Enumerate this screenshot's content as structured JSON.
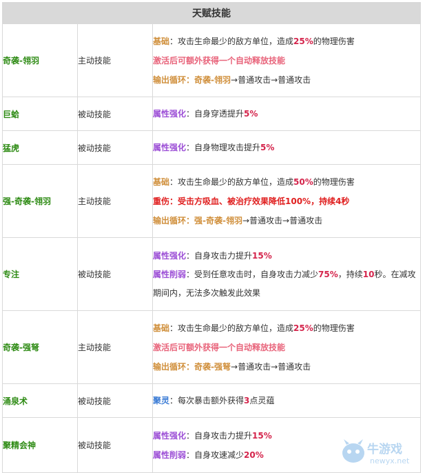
{
  "title": "天赋技能",
  "rows": [
    {
      "name": "奇袭-翎羽",
      "type": "主动技能",
      "lines": [
        [
          {
            "t": "基础",
            "c": "k-orange"
          },
          {
            "t": "：攻击生命最少的敌方单位，造成"
          },
          {
            "t": "25%",
            "c": "hl"
          },
          {
            "t": "的物理伤害"
          }
        ],
        [
          {
            "t": "激活后可额外获得一个自动释放技能",
            "c": "t-pink"
          }
        ],
        [
          {
            "t": "输出循环",
            "c": "k-orange"
          },
          {
            "t": "：",
            "c": "k-orange"
          },
          {
            "t": "奇袭-翎羽",
            "c": "k-orange"
          },
          {
            "t": "→普通攻击→普通攻击"
          }
        ]
      ]
    },
    {
      "name": "巨蛤",
      "type": "被动技能",
      "lines": [
        [
          {
            "t": "属性强化",
            "c": "k-purple"
          },
          {
            "t": "：自身穿透提升"
          },
          {
            "t": "5%",
            "c": "hl"
          }
        ]
      ]
    },
    {
      "name": "猛虎",
      "type": "被动技能",
      "lines": [
        [
          {
            "t": "属性强化",
            "c": "k-purple"
          },
          {
            "t": "：自身物理攻击提升"
          },
          {
            "t": "5%",
            "c": "hl"
          }
        ]
      ]
    },
    {
      "name": "强-奇袭-翎羽",
      "type": "主动技能",
      "lines": [
        [
          {
            "t": "基础",
            "c": "k-orange"
          },
          {
            "t": "：攻击生命最少的敌方单位，造成"
          },
          {
            "t": "50%",
            "c": "hl"
          },
          {
            "t": "的物理伤害"
          }
        ],
        [
          {
            "t": "重伤：受击方吸血、被治疗效果降低100%，持续4秒",
            "c": "t-red"
          }
        ],
        [
          {
            "t": "输出循环",
            "c": "k-orange"
          },
          {
            "t": "：",
            "c": "k-orange"
          },
          {
            "t": "强-奇袭-翎羽",
            "c": "k-orange"
          },
          {
            "t": "→普通攻击→普通攻击"
          }
        ]
      ]
    },
    {
      "name": "专注",
      "type": "被动技能",
      "lines": [
        [
          {
            "t": "属性强化",
            "c": "k-purple"
          },
          {
            "t": "：自身攻击力提升"
          },
          {
            "t": "15%",
            "c": "hl"
          }
        ],
        [
          {
            "t": "属性削弱",
            "c": "k-purple"
          },
          {
            "t": "：受到任意攻击时，自身攻击力减少"
          },
          {
            "t": "75%",
            "c": "hl"
          },
          {
            "t": "，持续"
          },
          {
            "t": "10",
            "c": "hl"
          },
          {
            "t": "秒。在减攻期间内，无法多次触发此效果"
          }
        ]
      ]
    },
    {
      "name": "奇袭-强弩",
      "type": "主动技能",
      "lines": [
        [
          {
            "t": "基础",
            "c": "k-orange"
          },
          {
            "t": "：攻击生命最少的敌方单位，造成"
          },
          {
            "t": "25%",
            "c": "hl"
          },
          {
            "t": "的物理伤害"
          }
        ],
        [
          {
            "t": "激活后可额外获得一个自动释放技能",
            "c": "t-pink"
          }
        ],
        [
          {
            "t": "输出循环",
            "c": "k-orange"
          },
          {
            "t": "：",
            "c": "k-orange"
          },
          {
            "t": "奇袭-强弩",
            "c": "k-orange"
          },
          {
            "t": "→普通攻击→普通攻击"
          }
        ]
      ]
    },
    {
      "name": "涌泉术",
      "type": "被动技能",
      "lines": [
        [
          {
            "t": "聚灵",
            "c": "k-blue"
          },
          {
            "t": "：每次暴击额外获得"
          },
          {
            "t": "3",
            "c": "hl"
          },
          {
            "t": "点灵蕴"
          }
        ]
      ]
    },
    {
      "name": "聚精会神",
      "type": "被动技能",
      "lines": [
        [
          {
            "t": "属性强化",
            "c": "k-purple"
          },
          {
            "t": "：自身攻击力提升"
          },
          {
            "t": "15%",
            "c": "hl"
          }
        ],
        [
          {
            "t": "属性削弱",
            "c": "k-purple"
          },
          {
            "t": "：自身攻速减少"
          },
          {
            "t": "20%",
            "c": "hl"
          }
        ]
      ]
    }
  ],
  "watermark": {
    "cn": "牛游戏",
    "en": "newyx.net"
  }
}
